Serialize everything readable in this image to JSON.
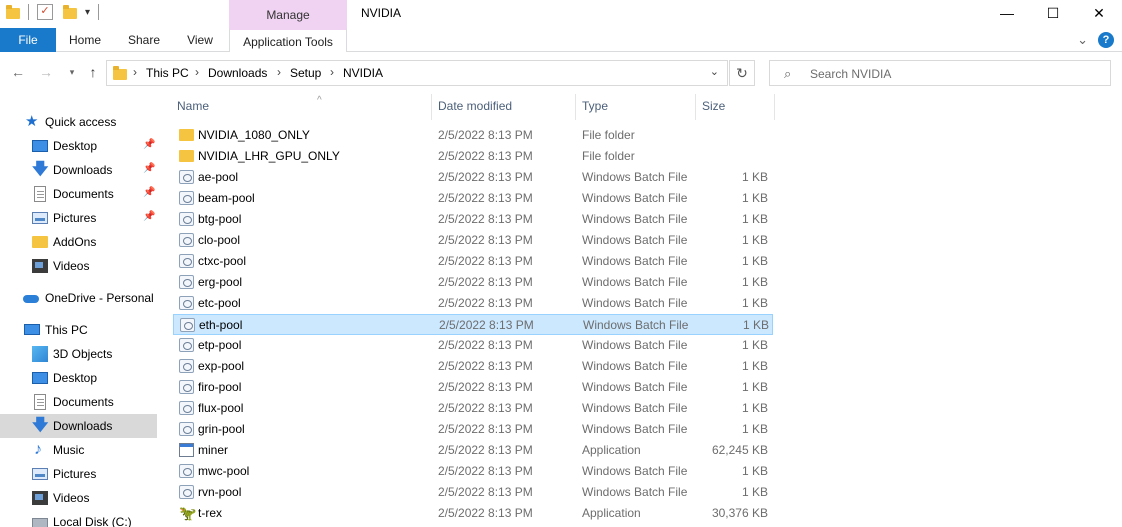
{
  "window": {
    "title": "NVIDIA",
    "context_tab": "Manage",
    "minimize": "—",
    "maximize": "☐",
    "close": "✕"
  },
  "ribbon": {
    "tabs": [
      "File",
      "Home",
      "Share",
      "View",
      "Application Tools"
    ],
    "collapse": "⌄",
    "help": "?"
  },
  "address": {
    "breadcrumbs": [
      "This PC",
      "Downloads",
      "Setup",
      "NVIDIA"
    ],
    "search_placeholder": "Search NVIDIA"
  },
  "nav": {
    "items": [
      {
        "label": "Quick access",
        "icon": "star-icon",
        "pinned": false
      },
      {
        "label": "Desktop",
        "icon": "desktop-icon",
        "pinned": true
      },
      {
        "label": "Downloads",
        "icon": "download-icon",
        "pinned": true
      },
      {
        "label": "Documents",
        "icon": "documents-icon",
        "pinned": true
      },
      {
        "label": "Pictures",
        "icon": "pictures-icon",
        "pinned": true
      },
      {
        "label": "AddOns",
        "icon": "folder-icon",
        "pinned": false
      },
      {
        "label": "Videos",
        "icon": "videos-icon",
        "pinned": false
      },
      {
        "label": "OneDrive - Personal",
        "icon": "onedrive-icon",
        "pinned": false
      },
      {
        "label": "This PC",
        "icon": "this-pc-icon",
        "pinned": false
      },
      {
        "label": "3D Objects",
        "icon": "3d-objects-icon",
        "pinned": false
      },
      {
        "label": "Desktop",
        "icon": "desktop-icon",
        "pinned": false
      },
      {
        "label": "Documents",
        "icon": "documents-icon",
        "pinned": false
      },
      {
        "label": "Downloads",
        "icon": "download-icon",
        "pinned": false,
        "selected": true
      },
      {
        "label": "Music",
        "icon": "music-icon",
        "pinned": false
      },
      {
        "label": "Pictures",
        "icon": "pictures-icon",
        "pinned": false
      },
      {
        "label": "Videos",
        "icon": "videos-icon",
        "pinned": false
      },
      {
        "label": "Local Disk (C:)",
        "icon": "local-disk-icon",
        "pinned": false
      }
    ]
  },
  "columns": {
    "name": "Name",
    "date": "Date modified",
    "type": "Type",
    "size": "Size"
  },
  "files": [
    {
      "name": "NVIDIA_1080_ONLY",
      "date": "2/5/2022 8:13 PM",
      "type": "File folder",
      "size": "",
      "icon": "folder"
    },
    {
      "name": "NVIDIA_LHR_GPU_ONLY",
      "date": "2/5/2022 8:13 PM",
      "type": "File folder",
      "size": "",
      "icon": "folder"
    },
    {
      "name": "ae-pool",
      "date": "2/5/2022 8:13 PM",
      "type": "Windows Batch File",
      "size": "1 KB",
      "icon": "batch"
    },
    {
      "name": "beam-pool",
      "date": "2/5/2022 8:13 PM",
      "type": "Windows Batch File",
      "size": "1 KB",
      "icon": "batch"
    },
    {
      "name": "btg-pool",
      "date": "2/5/2022 8:13 PM",
      "type": "Windows Batch File",
      "size": "1 KB",
      "icon": "batch"
    },
    {
      "name": "clo-pool",
      "date": "2/5/2022 8:13 PM",
      "type": "Windows Batch File",
      "size": "1 KB",
      "icon": "batch"
    },
    {
      "name": "ctxc-pool",
      "date": "2/5/2022 8:13 PM",
      "type": "Windows Batch File",
      "size": "1 KB",
      "icon": "batch"
    },
    {
      "name": "erg-pool",
      "date": "2/5/2022 8:13 PM",
      "type": "Windows Batch File",
      "size": "1 KB",
      "icon": "batch"
    },
    {
      "name": "etc-pool",
      "date": "2/5/2022 8:13 PM",
      "type": "Windows Batch File",
      "size": "1 KB",
      "icon": "batch"
    },
    {
      "name": "eth-pool",
      "date": "2/5/2022 8:13 PM",
      "type": "Windows Batch File",
      "size": "1 KB",
      "icon": "batch",
      "selected": true
    },
    {
      "name": "etp-pool",
      "date": "2/5/2022 8:13 PM",
      "type": "Windows Batch File",
      "size": "1 KB",
      "icon": "batch"
    },
    {
      "name": "exp-pool",
      "date": "2/5/2022 8:13 PM",
      "type": "Windows Batch File",
      "size": "1 KB",
      "icon": "batch"
    },
    {
      "name": "firo-pool",
      "date": "2/5/2022 8:13 PM",
      "type": "Windows Batch File",
      "size": "1 KB",
      "icon": "batch"
    },
    {
      "name": "flux-pool",
      "date": "2/5/2022 8:13 PM",
      "type": "Windows Batch File",
      "size": "1 KB",
      "icon": "batch"
    },
    {
      "name": "grin-pool",
      "date": "2/5/2022 8:13 PM",
      "type": "Windows Batch File",
      "size": "1 KB",
      "icon": "batch"
    },
    {
      "name": "miner",
      "date": "2/5/2022 8:13 PM",
      "type": "Application",
      "size": "62,245 KB",
      "icon": "app"
    },
    {
      "name": "mwc-pool",
      "date": "2/5/2022 8:13 PM",
      "type": "Windows Batch File",
      "size": "1 KB",
      "icon": "batch"
    },
    {
      "name": "rvn-pool",
      "date": "2/5/2022 8:13 PM",
      "type": "Windows Batch File",
      "size": "1 KB",
      "icon": "batch"
    },
    {
      "name": "t-rex",
      "date": "2/5/2022 8:13 PM",
      "type": "Application",
      "size": "30,376 KB",
      "icon": "trex"
    }
  ],
  "colors": {
    "file_tab": "#1979ca",
    "manage_tab": "#f0d3f2",
    "selection": "#cce8ff",
    "nav_selected": "#d9d9d9"
  }
}
